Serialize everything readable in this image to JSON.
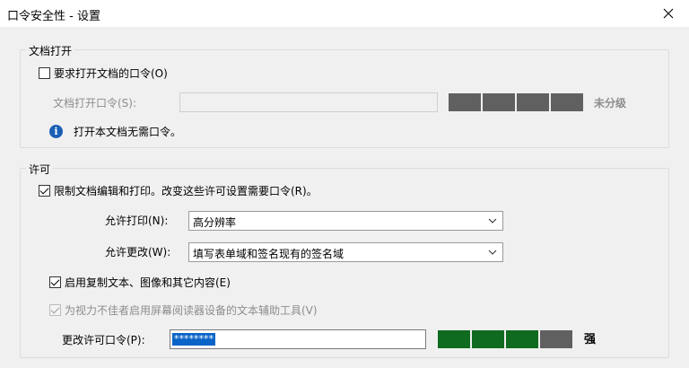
{
  "window": {
    "title": "口令安全性 - 设置",
    "close_icon": "close-icon"
  },
  "open_section": {
    "legend": "文档打开",
    "require_open_password": {
      "label": "要求打开文档的口令(O)",
      "checked": false
    },
    "open_password": {
      "label": "文档打开口令(S):",
      "value": ""
    },
    "strength": {
      "label": "未分级",
      "segments": [
        "#606060",
        "#606060",
        "#606060",
        "#606060"
      ]
    },
    "info_text": "打开本文档无需口令。"
  },
  "permissions_section": {
    "legend": "许可",
    "restrict_editing": {
      "label": "限制文档编辑和打印。改变这些许可设置需要口令(R)。",
      "checked": true
    },
    "printing_allowed": {
      "label": "允许打印(N):",
      "selected": "高分辨率"
    },
    "changes_allowed": {
      "label": "允许更改(W):",
      "selected": "填写表单域和签名现有的签名域"
    },
    "enable_copying": {
      "label": "启用复制文本、图像和其它内容(E)",
      "checked": true
    },
    "screen_reader": {
      "label": "为视力不佳者启用屏幕阅读器设备的文本辅助工具(V)",
      "checked": true,
      "disabled": true
    },
    "permissions_password": {
      "label": "更改许可口令(P):",
      "value": "********"
    },
    "strength": {
      "label": "强",
      "segments": [
        "#0f6b1f",
        "#0f6b1f",
        "#0f6b1f",
        "#606060"
      ]
    }
  }
}
